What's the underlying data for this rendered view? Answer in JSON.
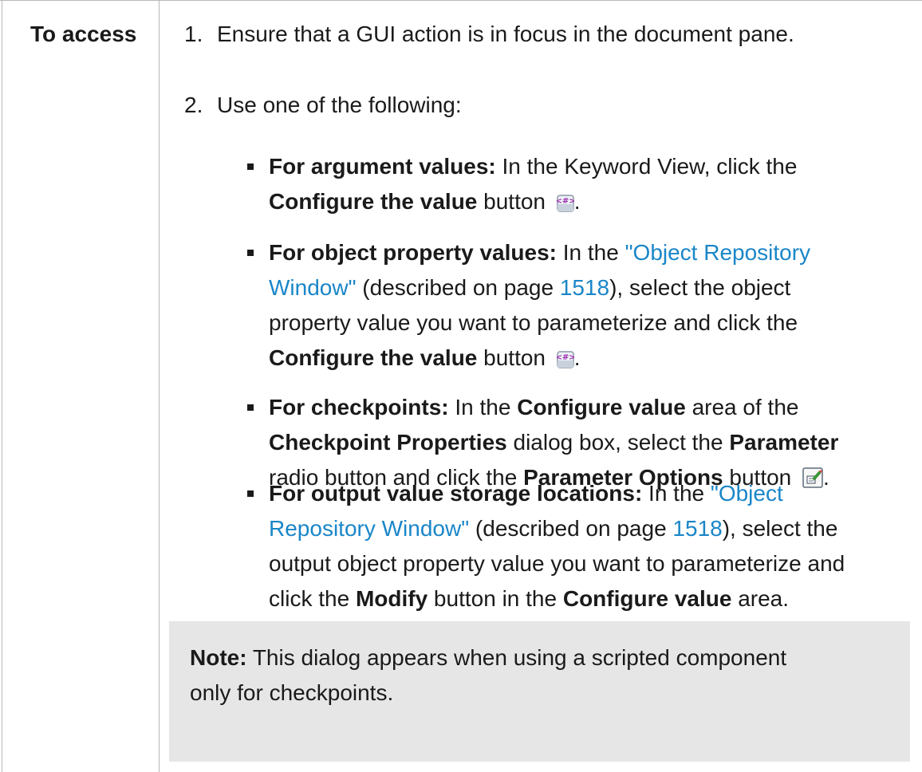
{
  "label": "To access",
  "steps": [
    {
      "num": "1.",
      "text": "Ensure that a GUI action is in focus in the document pane."
    },
    {
      "num": "2.",
      "text": "Use one of the following:"
    }
  ],
  "b1": {
    "bold1": "For argument values:",
    "t1": " In the Keyword View, click the",
    "bold2": "Configure the value",
    "t2": " button ",
    "t3": "."
  },
  "b2": {
    "bold1": "For object property values:",
    "t1": " In the ",
    "link1": "\"Object Repository",
    "link2": "Window\"",
    "t2": " (described on page ",
    "page": "1518",
    "t3": "), select the object",
    "t4": "property value you want to parameterize and click the",
    "bold2": "Configure the value",
    "t5": " button ",
    "t6": "."
  },
  "b3": {
    "bold1": "For checkpoints:",
    "t1": " In the ",
    "bold2": "Configure value",
    "t2": " area of the",
    "bold3": "Checkpoint Properties",
    "t3": " dialog box, select the ",
    "bold4": "Parameter",
    "t4": "radio button and click the ",
    "bold5": "Parameter Options",
    "t5": " button ",
    "t6": "."
  },
  "b4": {
    "bold1": "For output value storage locations:",
    "t1": " In the ",
    "link1": "\"Object",
    "link2": "Repository Window\"",
    "t2": " (described on page ",
    "page": "1518",
    "t3": "), select the",
    "t4": "output object property value you want to parameterize and",
    "t5": "click the ",
    "bold2": "Modify",
    "t6": " button in the ",
    "bold3": "Configure value",
    "t7": " area."
  },
  "note": {
    "bold": "Note:",
    "t1": " This dialog appears when using a scripted component",
    "t2": "only for checkpoints."
  },
  "icons": {
    "configure_value": "configure-value-icon",
    "parameter_options": "parameter-options-icon"
  },
  "colors": {
    "link": "#1a86c8",
    "note_bg": "#e6e6e6",
    "border": "#b8b8b8",
    "icon_purple": "#9b2fae"
  }
}
